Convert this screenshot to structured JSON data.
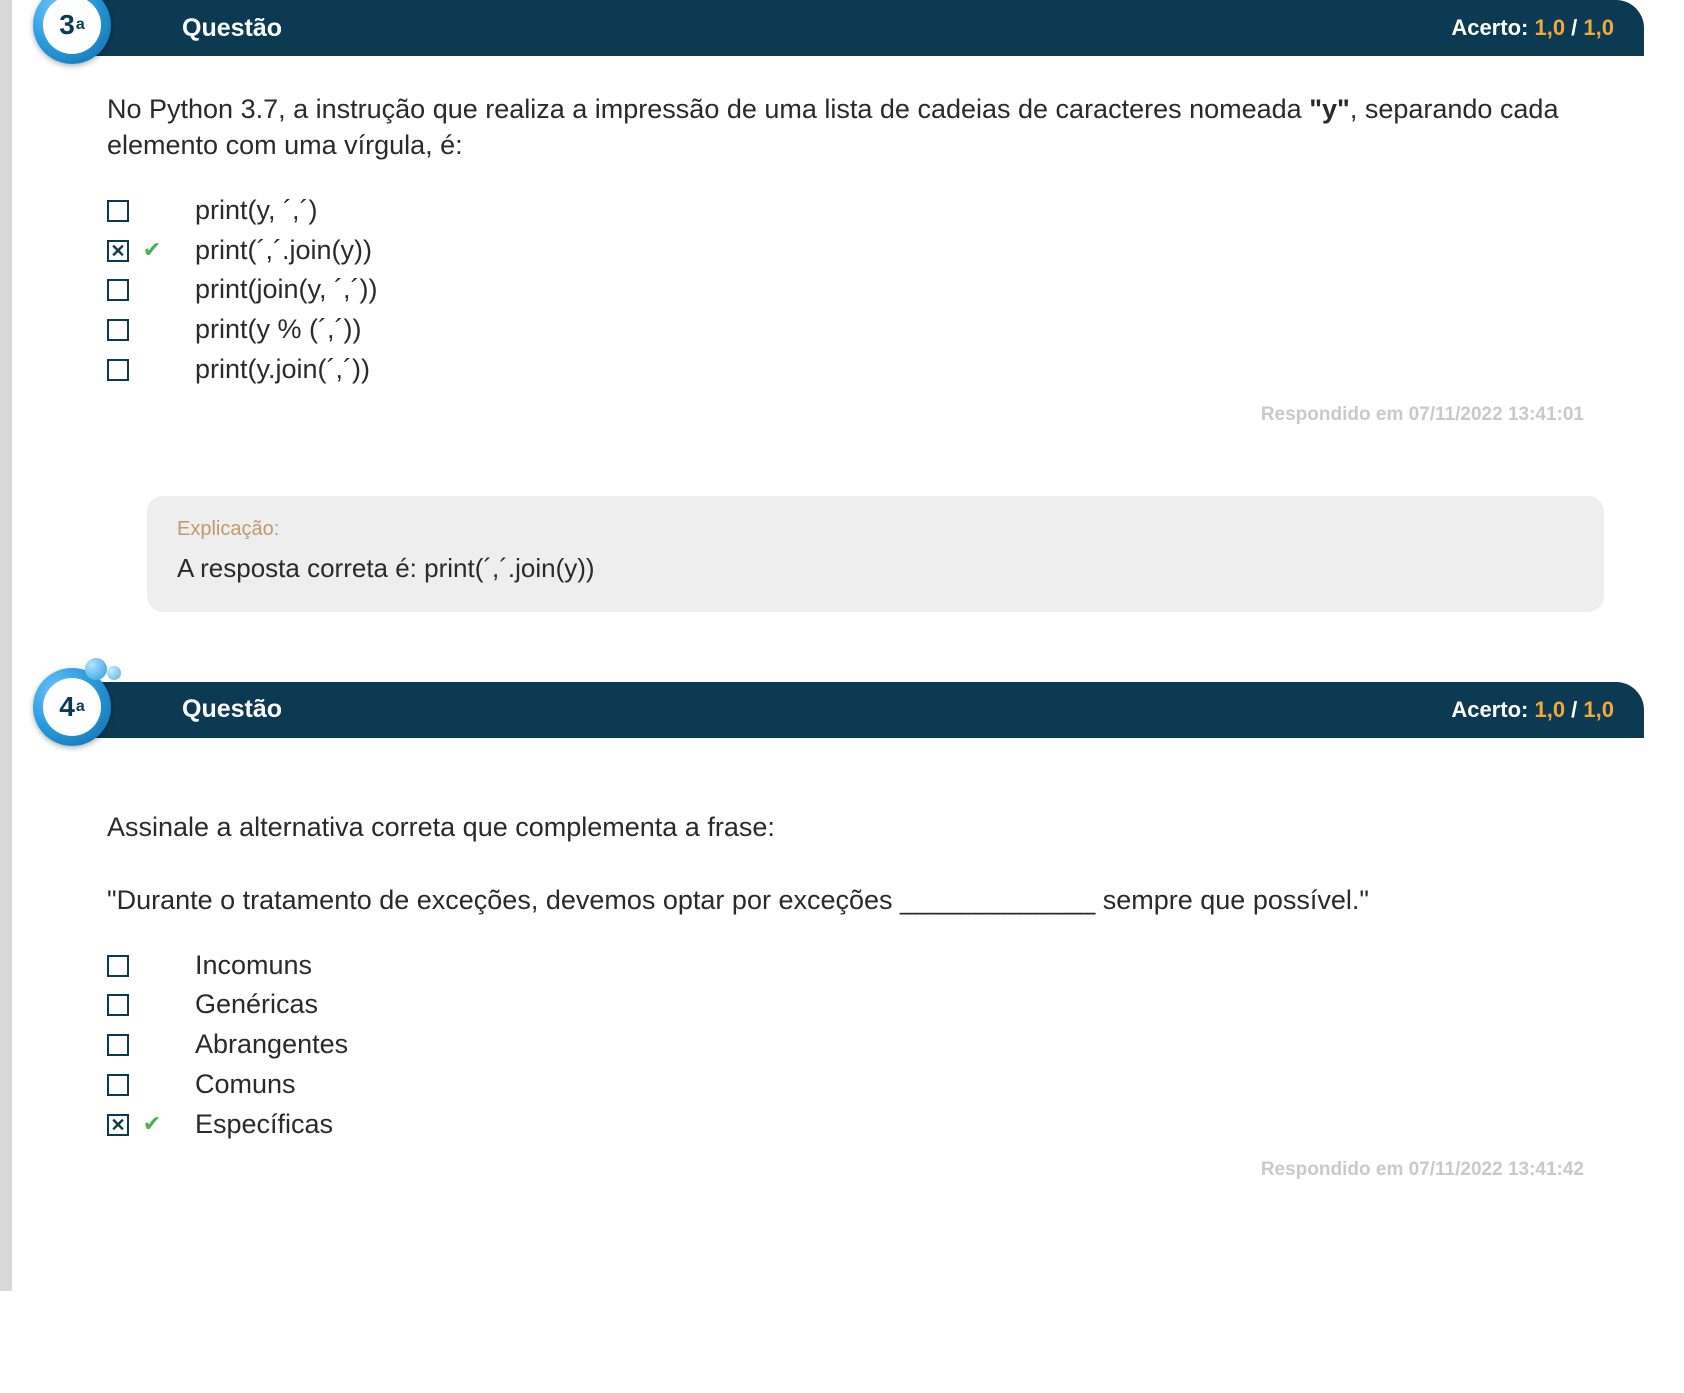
{
  "questions": [
    {
      "number": "3",
      "ordinal": "a",
      "header_label": "Questão",
      "score_label": "Acerto:",
      "score_value": "1,0",
      "score_sep": " / ",
      "score_max": "1,0",
      "prompt_pre": "No Python 3.7, a instrução que realiza a impressão de uma lista de cadeias de caracteres nomeada ",
      "prompt_bold": "\"y\"",
      "prompt_post": ", separando cada elemento com uma vírgula, é:",
      "options": [
        {
          "text": "print(y, ´,´)",
          "checked": false,
          "correct": false
        },
        {
          "text": "print(´,´.join(y))",
          "checked": true,
          "correct": true
        },
        {
          "text": "print(join(y, ´,´))",
          "checked": false,
          "correct": false
        },
        {
          "text": "print(y % (´,´))",
          "checked": false,
          "correct": false
        },
        {
          "text": "print(y.join(´,´))",
          "checked": false,
          "correct": false
        }
      ],
      "answered_at": "Respondido em 07/11/2022 13:41:01",
      "explanation_label": "Explicação:",
      "explanation_text": "A resposta correta é: print(´,´.join(y))"
    },
    {
      "number": "4",
      "ordinal": "a",
      "header_label": "Questão",
      "score_label": "Acerto:",
      "score_value": "1,0",
      "score_sep": " / ",
      "score_max": "1,0",
      "prompt_pre": "Assinale a alternativa correta que complementa a frase:\n\n\"Durante o tratamento de exceções, devemos optar por exceções _____________ sempre que possível.\"",
      "prompt_bold": "",
      "prompt_post": "",
      "options": [
        {
          "text": "Incomuns",
          "checked": false,
          "correct": false
        },
        {
          "text": "Genéricas",
          "checked": false,
          "correct": false
        },
        {
          "text": "Abrangentes",
          "checked": false,
          "correct": false
        },
        {
          "text": "Comuns",
          "checked": false,
          "correct": false
        },
        {
          "text": "Específicas",
          "checked": true,
          "correct": true
        }
      ],
      "answered_at": "Respondido em 07/11/2022 13:41:42",
      "explanation_label": "",
      "explanation_text": ""
    }
  ]
}
